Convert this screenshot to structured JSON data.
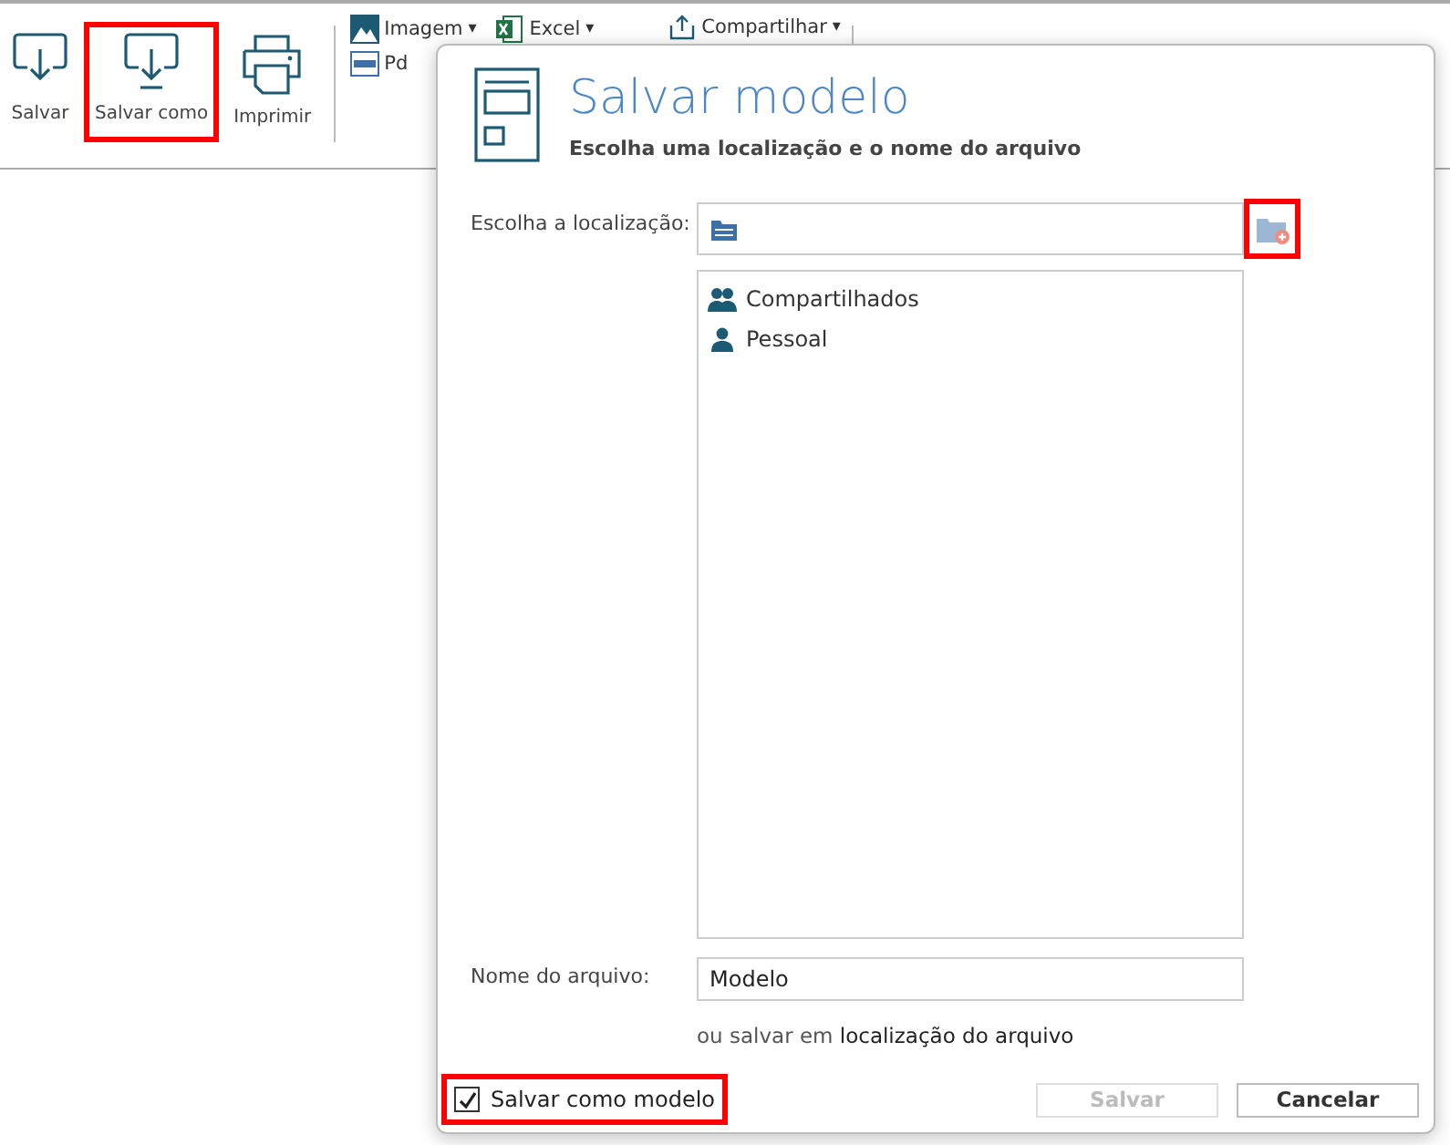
{
  "toolbar": {
    "buttons": [
      {
        "label": "Salvar",
        "kind": "save",
        "highlighted": false
      },
      {
        "label": "Salvar como",
        "kind": "saveas",
        "highlighted": true
      },
      {
        "label": "Imprimir",
        "kind": "print",
        "highlighted": false
      }
    ],
    "export": [
      {
        "label": "Imagem",
        "kind": "image",
        "dropdown": true
      },
      {
        "label": "Pd",
        "kind": "pdf",
        "dropdown": false
      },
      {
        "label": "Excel",
        "kind": "excel",
        "dropdown": true
      },
      {
        "label": "Compartilhar",
        "kind": "share",
        "dropdown": true
      }
    ],
    "dropdown_glyph": "▾"
  },
  "dialog": {
    "title": "Salvar modelo",
    "subtitle": "Escolha uma localização e o nome do arquivo",
    "location_label": "Escolha a localização:",
    "new_folder_highlighted": true,
    "locations": [
      {
        "label": "Compartilhados",
        "kind": "group",
        "selected": false
      },
      {
        "label": "Pessoal",
        "kind": "person",
        "selected": false
      }
    ],
    "filename_label": "Nome do arquivo:",
    "filename": "Modelo",
    "alt_prefix": "ou salvar em",
    "alt_link": "localização do arquivo",
    "save_as_template": {
      "label": "Salvar como modelo",
      "checked": true,
      "highlighted": true
    },
    "buttons": [
      {
        "label": "Salvar",
        "disabled": true
      },
      {
        "label": "Cancelar",
        "disabled": false
      }
    ]
  }
}
